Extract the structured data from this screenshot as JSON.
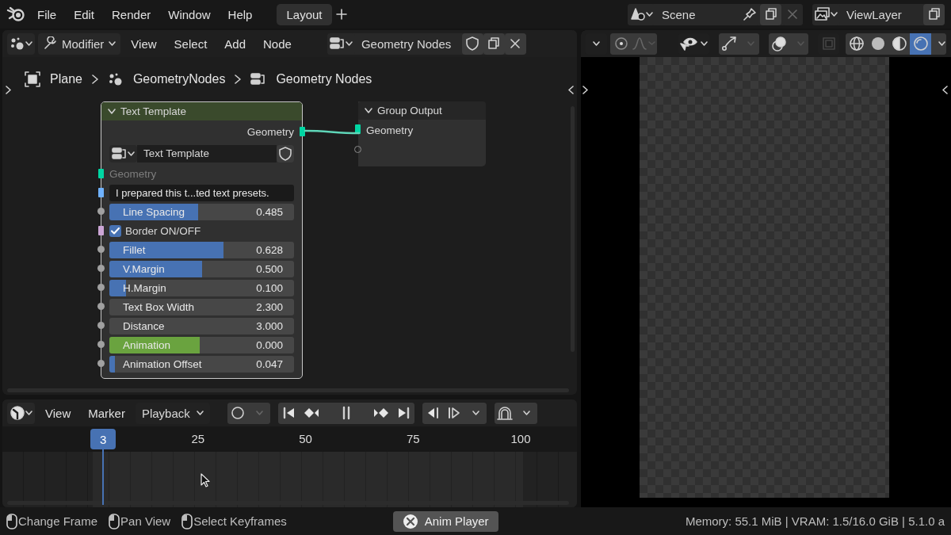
{
  "topbar": {
    "menus": [
      "File",
      "Edit",
      "Render",
      "Window",
      "Help"
    ],
    "workspace_tabs": [
      {
        "label": "Layout",
        "selected": true
      }
    ],
    "scene": "Scene",
    "view_layer": "ViewLayer"
  },
  "node_editor": {
    "header": {
      "mode": "Modifier",
      "menus": [
        "View",
        "Select",
        "Add",
        "Node"
      ],
      "node_group": "Geometry Nodes"
    },
    "breadcrumbs": [
      "Plane",
      "GeometryNodes",
      "Geometry Nodes"
    ],
    "nodes": [
      {
        "kind": "group",
        "title": "Text Template",
        "output": "Geometry",
        "group_name": "Text Template",
        "inputs": [
          {
            "kind": "geometry",
            "label": "Geometry"
          },
          {
            "kind": "text",
            "value": "I prepared this t...ted text presets."
          },
          {
            "kind": "slider",
            "label": "Line Spacing",
            "value": "0.485",
            "level": 0.48,
            "color": "#4772b3"
          },
          {
            "kind": "checkbox",
            "label": "Border ON/OFF",
            "checked": true
          },
          {
            "kind": "slider",
            "label": "Fillet",
            "value": "0.628",
            "level": 0.62,
            "color": "#4772b3"
          },
          {
            "kind": "slider",
            "label": "V.Margin",
            "value": "0.500",
            "level": 0.5,
            "color": "#4772b3"
          },
          {
            "kind": "slider",
            "label": "H.Margin",
            "value": "0.100",
            "level": 0.09,
            "color": "#4772b3"
          },
          {
            "kind": "number",
            "label": "Text Box Width",
            "value": "2.300"
          },
          {
            "kind": "number",
            "label": "Distance",
            "value": "3.000"
          },
          {
            "kind": "slider",
            "label": "Animation",
            "value": "0.000",
            "level": 0.49,
            "color": "#6aa33f"
          },
          {
            "kind": "slider",
            "label": "Animation Offset",
            "value": "0.047",
            "level": 0.03,
            "color": "#4772b3"
          }
        ]
      },
      {
        "kind": "output",
        "title": "Group Output",
        "inputs": [
          {
            "kind": "geometry",
            "label": "Geometry"
          },
          {
            "kind": "empty"
          }
        ]
      }
    ]
  },
  "timeline": {
    "menus": [
      "View",
      "Marker"
    ],
    "playback": "Playback",
    "playing": true,
    "current_frame": "3",
    "ruler": [
      "25",
      "50",
      "75",
      "100"
    ]
  },
  "viewport": {
    "shading_modes": [
      {
        "kind": "wireframe",
        "selected": false
      },
      {
        "kind": "solid",
        "selected": false
      },
      {
        "kind": "material",
        "selected": false
      },
      {
        "kind": "rendered",
        "selected": true
      }
    ]
  },
  "status_bar": {
    "hints": [
      "Change Frame",
      "Pan View",
      "Select Keyframes"
    ],
    "job": "Anim Player",
    "stats": "Memory: 55.1 MiB | VRAM: 1.5/16.0 GiB | 5.1.0 a"
  }
}
